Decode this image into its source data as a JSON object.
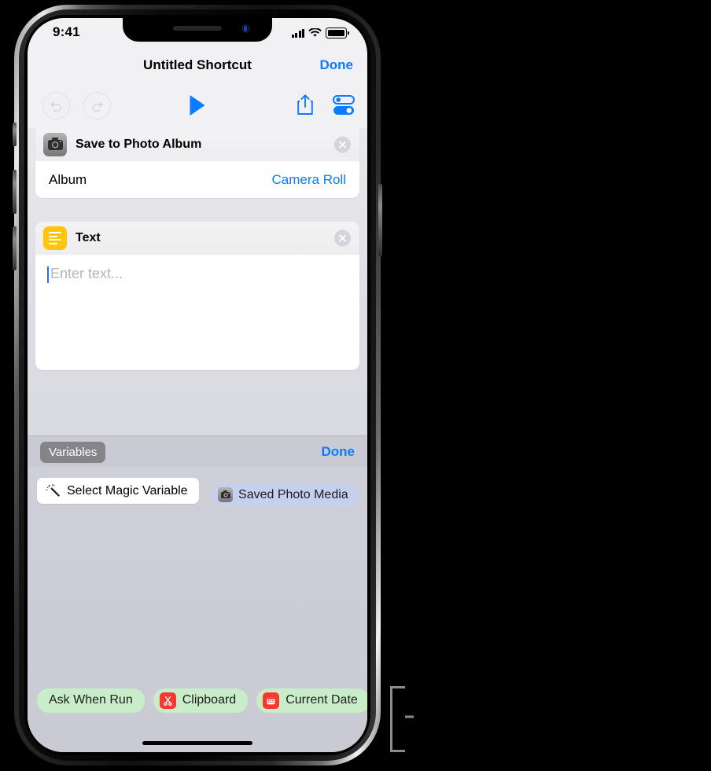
{
  "status_bar": {
    "time": "9:41",
    "cellular_icon": "cellular-bars-icon",
    "wifi_icon": "wifi-icon",
    "battery_icon": "battery-icon"
  },
  "nav_bar": {
    "title": "Untitled Shortcut",
    "done_label": "Done"
  },
  "toolbar": {
    "undo_icon": "undo-icon",
    "redo_icon": "redo-icon",
    "play_icon": "play-icon",
    "share_icon": "share-icon",
    "settings_icon": "settings-sliders-icon"
  },
  "actions": [
    {
      "title": "Save to Photo Album",
      "icon": "camera-icon",
      "remove_icon": "close-circle-icon",
      "parameters": [
        {
          "label": "Album",
          "value": "Camera Roll"
        }
      ]
    },
    {
      "title": "Text",
      "icon": "text-lines-icon",
      "remove_icon": "close-circle-icon",
      "text_field": {
        "value": "",
        "placeholder": "Enter text..."
      }
    }
  ],
  "variables_bar": {
    "chip_label": "Variables",
    "done_label": "Done"
  },
  "variables_panel": {
    "select_magic_variable": {
      "label": "Select Magic Variable",
      "icon": "magic-wand-icon"
    },
    "magic_variable": {
      "label": "Saved Photo Media",
      "icon": "camera-icon"
    }
  },
  "suggestions": [
    {
      "label": "Ask When Run",
      "icon": null
    },
    {
      "label": "Clipboard",
      "icon": "scissors-icon"
    },
    {
      "label": "Current Date",
      "icon": "calendar-icon"
    }
  ],
  "home_indicator": "home-indicator",
  "colors": {
    "accent_blue": "#0a7cff",
    "suggestion_green": "#c9edc9",
    "magic_variable_blue": "#c6d0ec",
    "text_action_yellow": "#ffc60b",
    "icon_red": "#f8372f"
  }
}
